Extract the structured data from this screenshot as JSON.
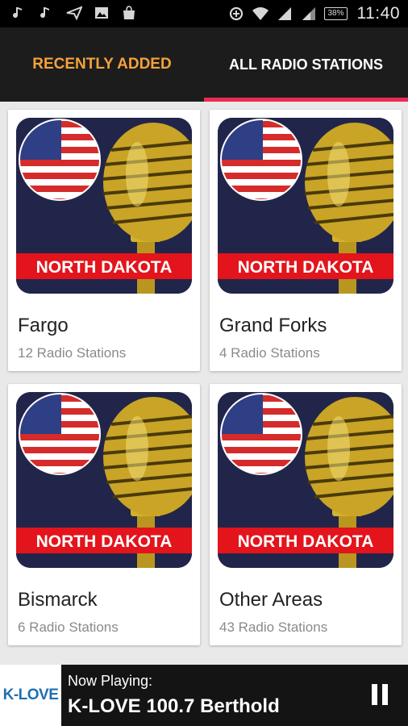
{
  "status_bar": {
    "left_icons": [
      "music-note-icon",
      "music-note-icon",
      "send-icon",
      "image-icon",
      "shopping-bag-icon"
    ],
    "battery": "38%",
    "time": "11:40"
  },
  "tabs": [
    {
      "label": "RECENTLY ADDED",
      "selected": false
    },
    {
      "label": "ALL RADIO STATIONS",
      "selected": true
    }
  ],
  "colors": {
    "tab_recent": "#f5a13c",
    "tab_indicator": "#ec2a55",
    "banner_red": "#e3141c",
    "art_background": "#22254a"
  },
  "cards": [
    {
      "banner": "NORTH DAKOTA",
      "name": "Fargo",
      "count": "12 Radio Stations"
    },
    {
      "banner": "NORTH DAKOTA",
      "name": "Grand Forks",
      "count": "4 Radio Stations"
    },
    {
      "banner": "NORTH DAKOTA",
      "name": "Bismarck",
      "count": "6 Radio Stations"
    },
    {
      "banner": "NORTH DAKOTA",
      "name": "Other Areas",
      "count": "43 Radio Stations"
    }
  ],
  "now_playing": {
    "logo_text": "K-LOVE",
    "label": "Now Playing:",
    "title": "K-LOVE 100.7 Berthold"
  }
}
